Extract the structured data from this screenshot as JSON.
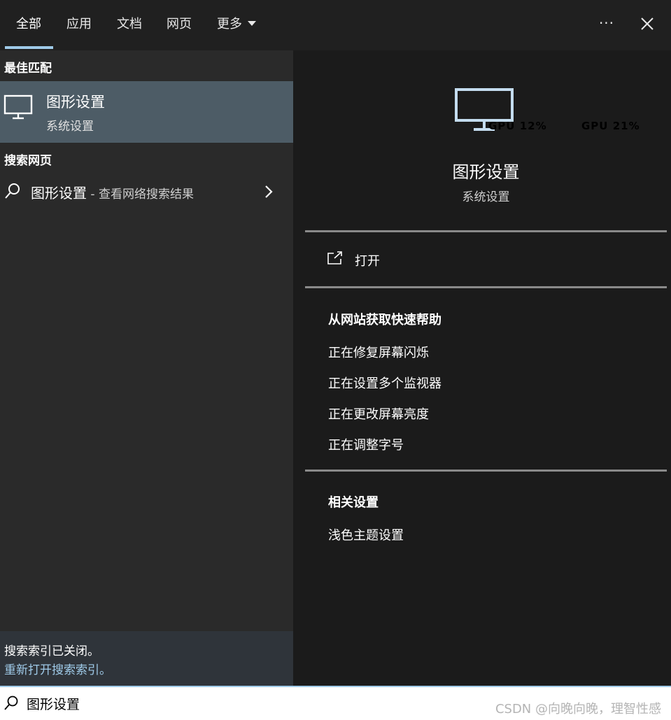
{
  "tabs": [
    {
      "label": "全部"
    },
    {
      "label": "应用"
    },
    {
      "label": "文档"
    },
    {
      "label": "网页"
    },
    {
      "label": "更多"
    }
  ],
  "more_options_label": "···",
  "left": {
    "best_match_header": "最佳匹配",
    "best_match": {
      "icon": "monitor-icon",
      "title": "图形设置",
      "subtitle": "系统设置"
    },
    "web_header": "搜索网页",
    "web_result": {
      "icon": "search-icon",
      "query": "图形设置",
      "suffix": " - 查看网络搜索结果"
    },
    "index_notice": {
      "line1": "搜索索引已关闭。",
      "line2": "重新打开搜索索引。"
    }
  },
  "preview": {
    "icon": "monitor-icon",
    "title": "图形设置",
    "subtitle": "系统设置",
    "overlay": {
      "gpu1": "GPU  12%",
      "gpu2": "GPU  21%"
    },
    "open_label": "打开",
    "web_help": {
      "title": "从网站获取快速帮助",
      "links": [
        "正在修复屏幕闪烁",
        "正在设置多个监视器",
        "正在更改屏幕亮度",
        "正在调整字号"
      ]
    },
    "related": {
      "title": "相关设置",
      "links": [
        "浅色主题设置"
      ]
    }
  },
  "search": {
    "value": "图形设置",
    "icon": "search-icon"
  },
  "watermark": "CSDN @向晚向晚，理智性感",
  "colors": {
    "accent": "#9fcae8",
    "selected_item": "#4d5c66",
    "left_pane": "#2a2a2a",
    "right_pane": "#1b1b1b"
  }
}
